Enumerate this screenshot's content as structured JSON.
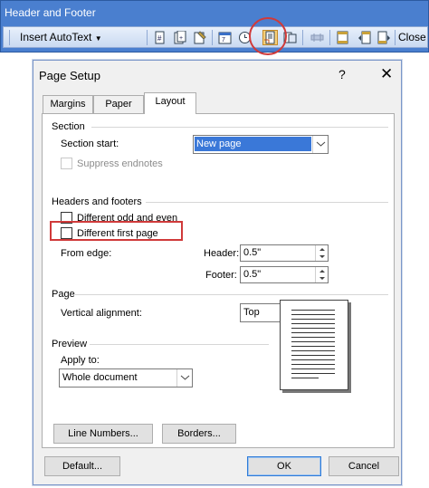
{
  "header_footer_bar": {
    "title": "Header and Footer",
    "insert_autotext_label": "Insert AutoText",
    "close_label": "Close"
  },
  "dialog": {
    "title": "Page Setup",
    "help": "?",
    "close": "✕",
    "tabs": [
      {
        "label": "Margins",
        "selected": false
      },
      {
        "label": "Paper",
        "selected": false
      },
      {
        "label": "Layout",
        "selected": true
      }
    ],
    "section": {
      "heading": "Section",
      "start_label": "Section start:",
      "start_value": "New page",
      "suppress_endnotes": "Suppress endnotes"
    },
    "headers_footers": {
      "heading": "Headers and footers",
      "odd_even": "Different odd and even",
      "first_page": "Different first page",
      "from_edge": "From edge:",
      "header_label": "Header:",
      "header_value": "0.5\"",
      "footer_label": "Footer:",
      "footer_value": "0.5\""
    },
    "page": {
      "heading": "Page",
      "valign_label": "Vertical alignment:",
      "valign_value": "Top"
    },
    "preview": {
      "heading": "Preview",
      "apply_label": "Apply to:",
      "apply_value": "Whole document"
    },
    "buttons": {
      "line_numbers": "Line Numbers...",
      "borders": "Borders...",
      "default": "Default...",
      "ok": "OK",
      "cancel": "Cancel"
    }
  },
  "colors": {
    "annotation_red": "#d03a3a",
    "toolbar_blue": "#4a7fcf",
    "selection_blue": "#3a78d8"
  }
}
